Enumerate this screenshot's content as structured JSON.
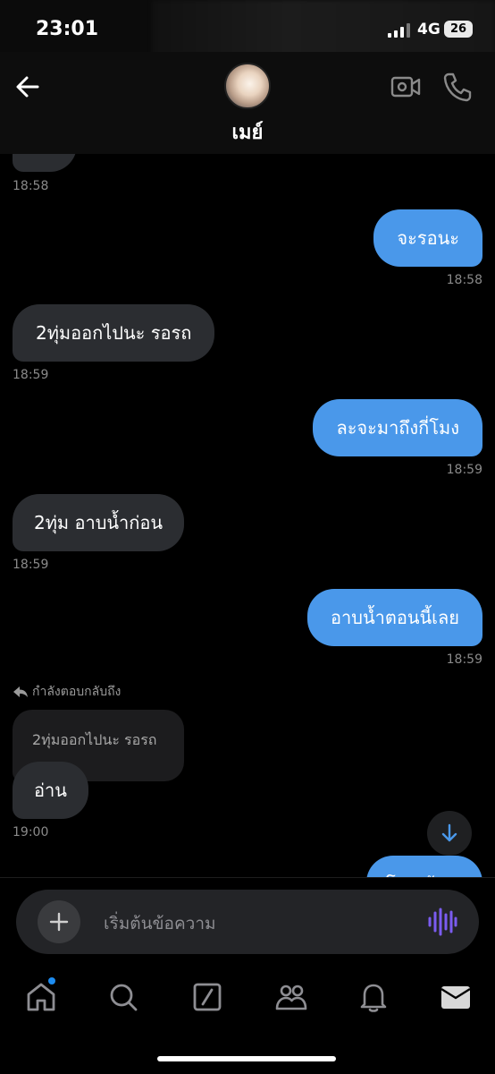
{
  "status": {
    "time": "23:01",
    "network": "4G",
    "battery": "26"
  },
  "header": {
    "contact_name": "เมย์"
  },
  "messages": [
    {
      "direction": "in",
      "text": "",
      "time": "18:58"
    },
    {
      "direction": "out",
      "text": "จะรอนะ",
      "time": "18:58"
    },
    {
      "direction": "in",
      "text": "2ทุ่มออกไปนะ รอรถ",
      "time": "18:59"
    },
    {
      "direction": "out",
      "text": "ละจะมาถึงกี่โมง",
      "time": "18:59"
    },
    {
      "direction": "in",
      "text": "2ทุ่ม อาบน้ำก่อน",
      "time": "18:59"
    },
    {
      "direction": "out",
      "text": "อาบน้ำตอนนี้เลย",
      "time": "18:59"
    },
    {
      "direction": "in",
      "reply_label": "กำลังตอบกลับถึง",
      "quoted_text": "2ทุ่มออกไปนะ รอรถ",
      "text": "อ่าน",
      "time": "19:00"
    },
    {
      "direction": "out",
      "text": "โอเคจ้ะ",
      "time": ""
    }
  ],
  "composer": {
    "placeholder": "เริ่มต้นข้อความ"
  },
  "tabs": [
    {
      "icon": "home-icon",
      "has_notification": true
    },
    {
      "icon": "search-icon"
    },
    {
      "icon": "compose-icon"
    },
    {
      "icon": "communities-icon"
    },
    {
      "icon": "bell-icon"
    },
    {
      "icon": "mail-icon",
      "active": true
    }
  ],
  "colors": {
    "outgoing_bubble": "#4a98ea",
    "incoming_bubble": "#2b2d31",
    "voice_accent": "#7b5cf0",
    "notification": "#1d8cf0"
  }
}
